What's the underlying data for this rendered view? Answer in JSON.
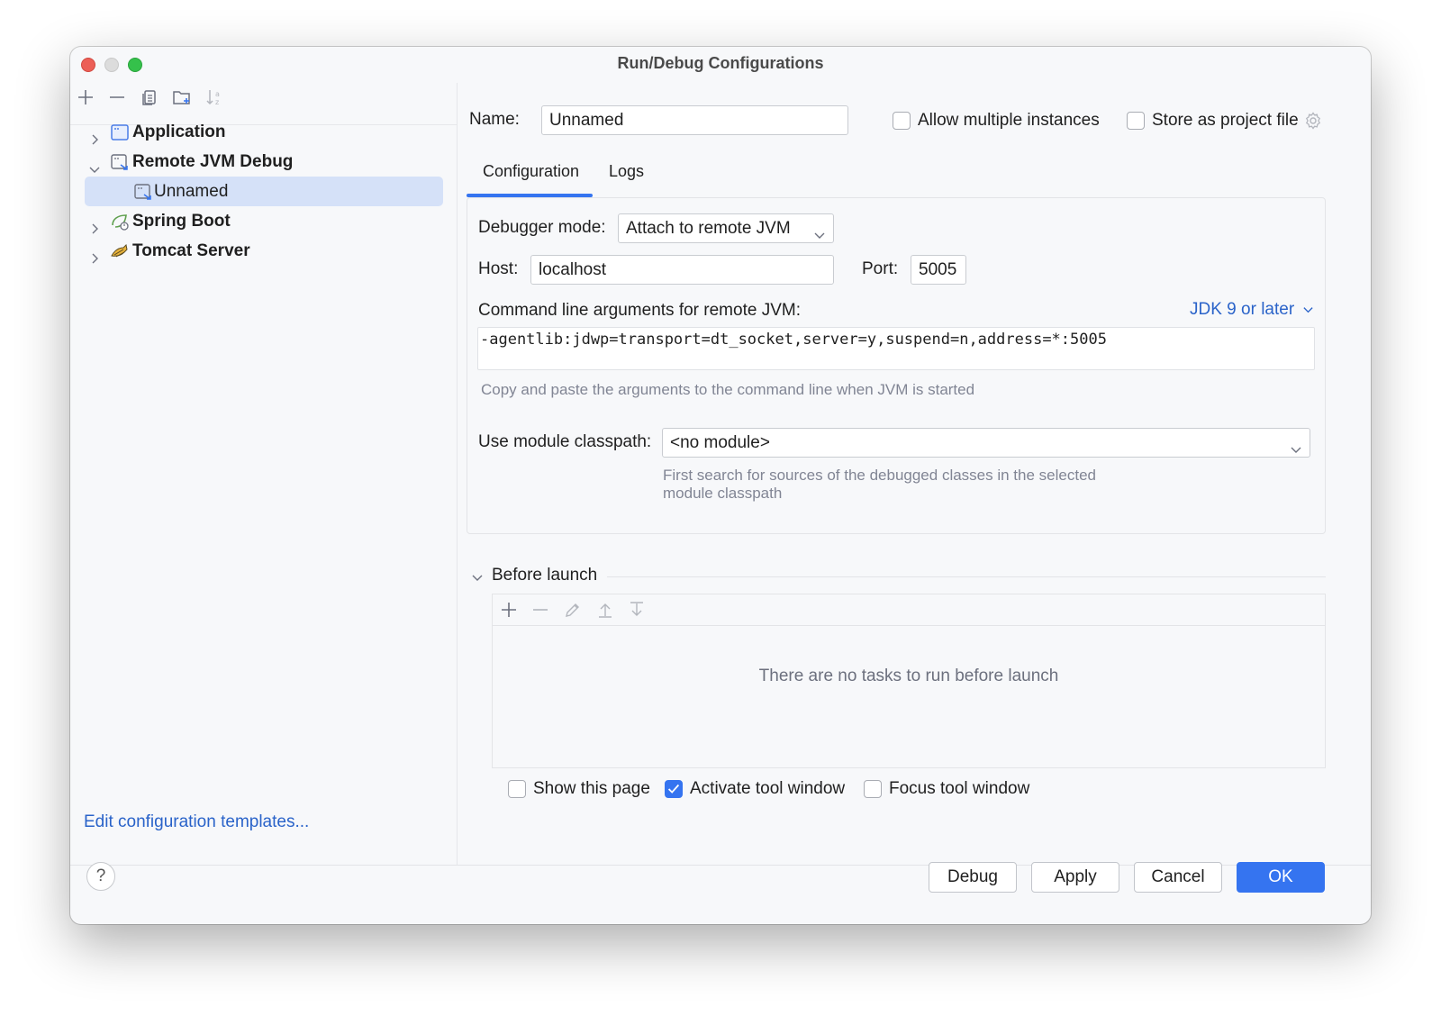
{
  "window": {
    "title": "Run/Debug Configurations"
  },
  "tree": {
    "items": [
      {
        "label": "Application",
        "bold": true
      },
      {
        "label": "Remote JVM Debug",
        "bold": true
      },
      {
        "label": "Unnamed",
        "bold": false
      },
      {
        "label": "Spring Boot",
        "bold": true
      },
      {
        "label": "Tomcat Server",
        "bold": true
      }
    ],
    "selected": "Unnamed"
  },
  "left": {
    "edit_templates": "Edit configuration templates..."
  },
  "form": {
    "name_label": "Name:",
    "name_value": "Unnamed",
    "allow_multiple_label": "Allow multiple instances",
    "store_project_label": "Store as project file",
    "tabs": [
      {
        "label": "Configuration"
      },
      {
        "label": "Logs"
      }
    ],
    "debugger_mode_label": "Debugger mode:",
    "debugger_mode_value": "Attach to remote JVM",
    "host_label": "Host:",
    "host_value": "localhost",
    "port_label": "Port:",
    "port_value": "5005",
    "cmd_label": "Command line arguments for remote JVM:",
    "jdk_link": "JDK 9 or later",
    "cmd_value": "-agentlib:jdwp=transport=dt_socket,server=y,suspend=n,address=*:5005",
    "cmd_hint": "Copy and paste the arguments to the command line when JVM is started",
    "module_label": "Use module classpath:",
    "module_value": "<no module>",
    "module_hint_1": "First search for sources of the debugged classes in the selected",
    "module_hint_2": "module classpath"
  },
  "before_launch": {
    "title": "Before launch",
    "empty_text": "There are no tasks to run before launch",
    "show_page_label": "Show this page",
    "activate_label": "Activate tool window",
    "focus_label": "Focus tool window"
  },
  "buttons": {
    "help": "?",
    "debug": "Debug",
    "apply": "Apply",
    "cancel": "Cancel",
    "ok": "OK"
  },
  "colors": {
    "accent": "#3574f0",
    "link": "#2a63c9",
    "selection": "#d5e1f8"
  }
}
